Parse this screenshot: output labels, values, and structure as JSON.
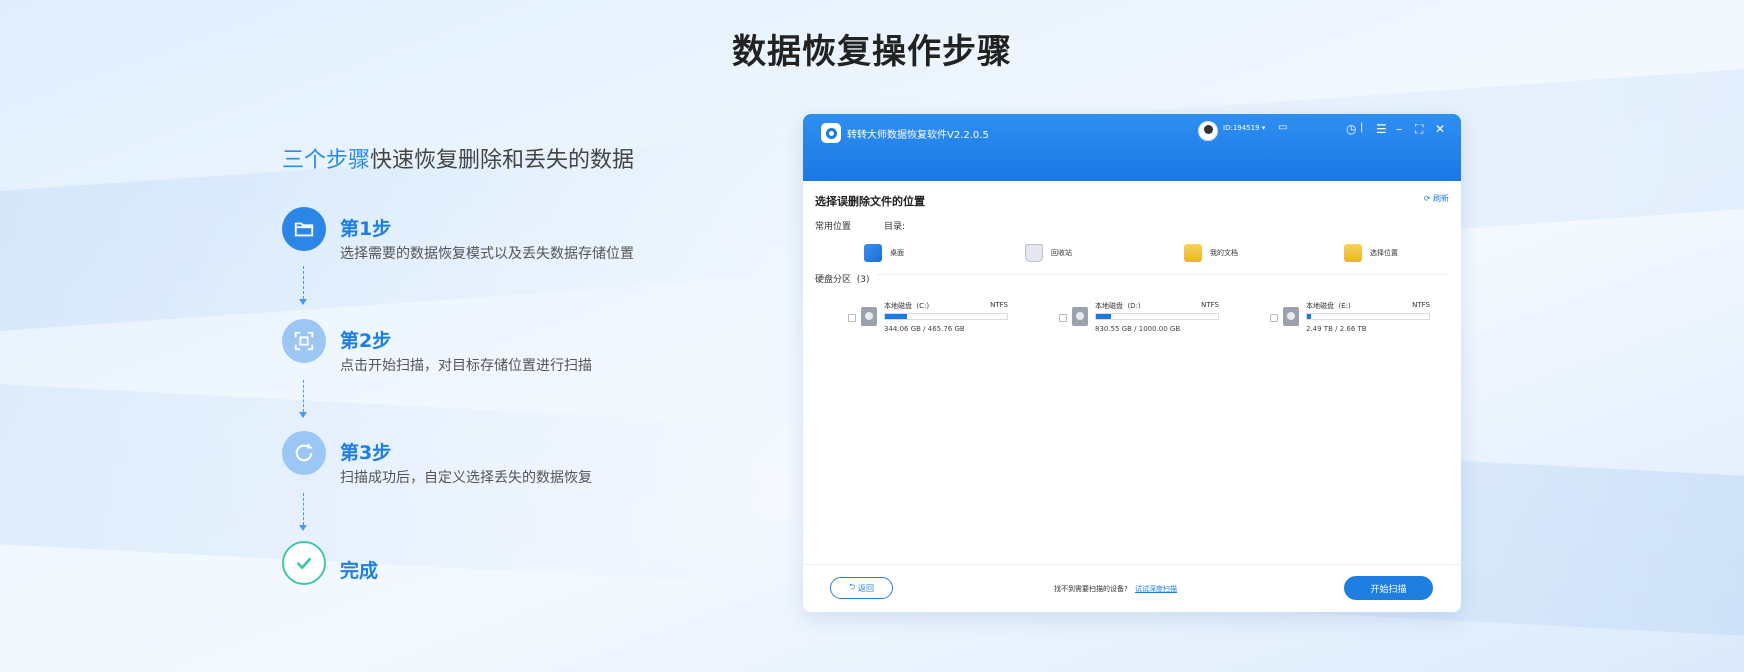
{
  "page": {
    "title": "数据恢复操作步骤",
    "subtitle_accent": "三个步骤",
    "subtitle_rest": "快速恢复删除和丢失的数据"
  },
  "steps": [
    {
      "title": "第1步",
      "desc": "选择需要的数据恢复模式以及丢失数据存储位置",
      "icon": "folder-icon"
    },
    {
      "title": "第2步",
      "desc": "点击开始扫描，对目标存储位置进行扫描",
      "icon": "scan-icon"
    },
    {
      "title": "第3步",
      "desc": "扫描成功后，自定义选择丢失的数据恢复",
      "icon": "refresh-icon"
    },
    {
      "title": "完成",
      "desc": "",
      "icon": "check-icon"
    }
  ],
  "app": {
    "name": "转转大师数据恢复软件V2.2.0.5",
    "user_id": "ID:194519",
    "section_title": "选择误删除文件的位置",
    "refresh_label": "刷新",
    "common_locations_label": "常用位置",
    "directory_label": "目录:",
    "locations": [
      {
        "label": "桌面",
        "icon": "desktop-icon"
      },
      {
        "label": "回收站",
        "icon": "recycle-bin-icon"
      },
      {
        "label": "我的文档",
        "icon": "documents-folder-icon"
      },
      {
        "label": "选择位置",
        "icon": "choose-location-icon"
      }
    ],
    "partition_label": "硬盘分区",
    "partition_count": "(3)",
    "drives": [
      {
        "name": "本地磁盘",
        "letter": "(C:)",
        "fs": "NTFS",
        "size": "344.06 GB / 465.76 GB",
        "used_fraction": 0.18
      },
      {
        "name": "本地磁盘",
        "letter": "(D:)",
        "fs": "NTFS",
        "size": "830.55 GB / 1000.00 GB",
        "used_fraction": 0.12
      },
      {
        "name": "本地磁盘",
        "letter": "(E:)",
        "fs": "NTFS",
        "size": "2.49 TB / 2.66 TB",
        "used_fraction": 0.03
      }
    ],
    "back_label": "返回",
    "help_text": "找不到需要扫描的设备?",
    "help_link": "试试深度扫描",
    "start_label": "开始扫描",
    "colors": {
      "accent": "#1f7fe0",
      "header": "#1b78e6",
      "done": "#3fc9a8"
    }
  }
}
